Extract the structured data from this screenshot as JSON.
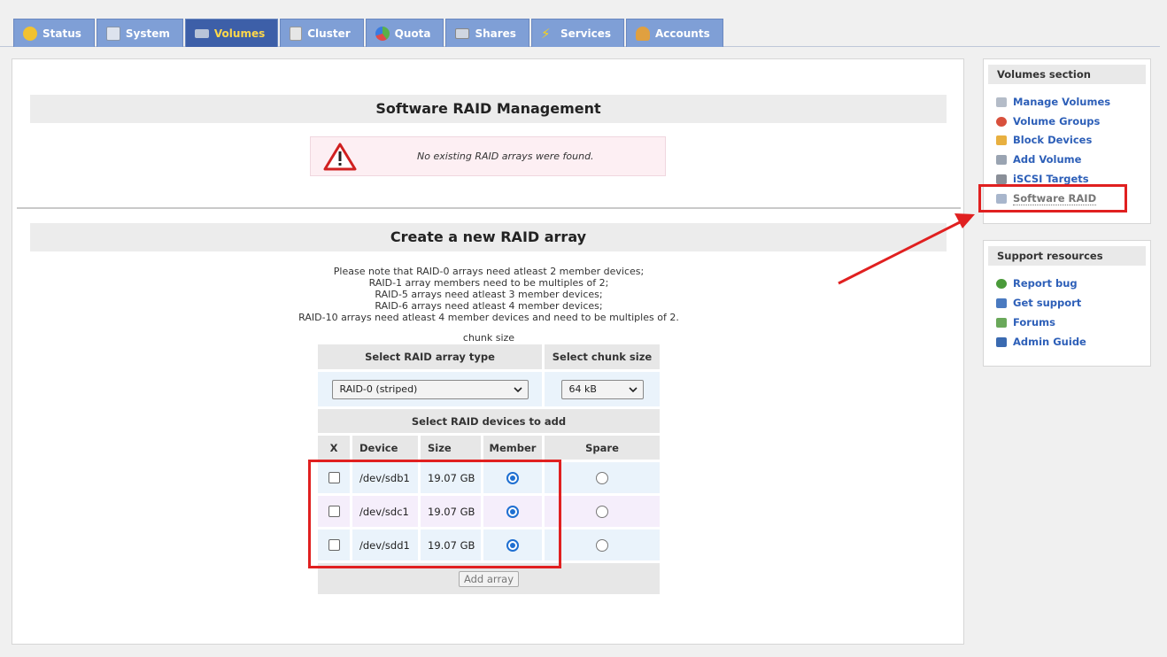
{
  "tabs": [
    {
      "label": "Status",
      "icon": "weather-icon",
      "color": "#f2c230"
    },
    {
      "label": "System",
      "icon": "monitor-icon",
      "color": "#dde3ee"
    },
    {
      "label": "Volumes",
      "icon": "disk-icon",
      "color": "#b8c4d8"
    },
    {
      "label": "Cluster",
      "icon": "servers-icon",
      "color": "#e6e6e6"
    },
    {
      "label": "Quota",
      "icon": "pie-icon",
      "color": "#5ab04a"
    },
    {
      "label": "Shares",
      "icon": "drives-icon",
      "color": "#d0d6e0"
    },
    {
      "label": "Services",
      "icon": "bolt-icon",
      "color": "#f7d21a"
    },
    {
      "label": "Accounts",
      "icon": "users-icon",
      "color": "#e0a040"
    }
  ],
  "main": {
    "management_title": "Software RAID Management",
    "warning_text": "No existing RAID arrays were found.",
    "create_title": "Create a new RAID array",
    "note_lines": [
      "Please note that RAID-0 arrays need atleast 2 member devices;",
      "RAID-1 array members need to be multiples of 2;",
      "RAID-5 arrays need atleast 3 member devices;",
      "RAID-6 arrays need atleast 4 member devices;",
      "RAID-10 arrays need atleast 4 member devices and need to be multiples of 2."
    ],
    "chunk_size_label": "chunk size"
  },
  "raid_form": {
    "type_header": "Select RAID array type",
    "chunk_header": "Select chunk size",
    "type_value": "RAID-0 (striped)",
    "chunk_value": "64 kB",
    "devices_header": "Select RAID devices to add",
    "columns": [
      "X",
      "Device",
      "Size",
      "Member",
      "Spare"
    ],
    "devices": [
      {
        "device": "/dev/sdb1",
        "size": "19.07 GB",
        "selected": false,
        "role": "member"
      },
      {
        "device": "/dev/sdc1",
        "size": "19.07 GB",
        "selected": false,
        "role": "member"
      },
      {
        "device": "/dev/sdd1",
        "size": "19.07 GB",
        "selected": false,
        "role": "member"
      }
    ],
    "add_button": "Add array"
  },
  "sidebar": {
    "volumes_title": "Volumes section",
    "volume_links": [
      {
        "label": "Manage Volumes",
        "icon": "drive-icon"
      },
      {
        "label": "Volume Groups",
        "icon": "volume-groups-icon"
      },
      {
        "label": "Block Devices",
        "icon": "block-devices-icon"
      },
      {
        "label": "Add Volume",
        "icon": "add-volume-icon"
      },
      {
        "label": "iSCSI Targets",
        "icon": "iscsi-icon"
      },
      {
        "label": "Software RAID",
        "icon": "raid-icon",
        "current": true
      }
    ],
    "support_title": "Support resources",
    "support_links": [
      {
        "label": "Report bug",
        "icon": "bug-icon"
      },
      {
        "label": "Get support",
        "icon": "support-icon"
      },
      {
        "label": "Forums",
        "icon": "forums-icon"
      },
      {
        "label": "Admin Guide",
        "icon": "guide-icon"
      }
    ]
  },
  "colors": {
    "tab_bg": "#7f9fd6",
    "tab_active_bg": "#3d5fa8",
    "tab_active_text": "#ffd84a",
    "link": "#2d5fb8",
    "annotation": "#e02020",
    "radio_on": "#1f6fd1"
  }
}
